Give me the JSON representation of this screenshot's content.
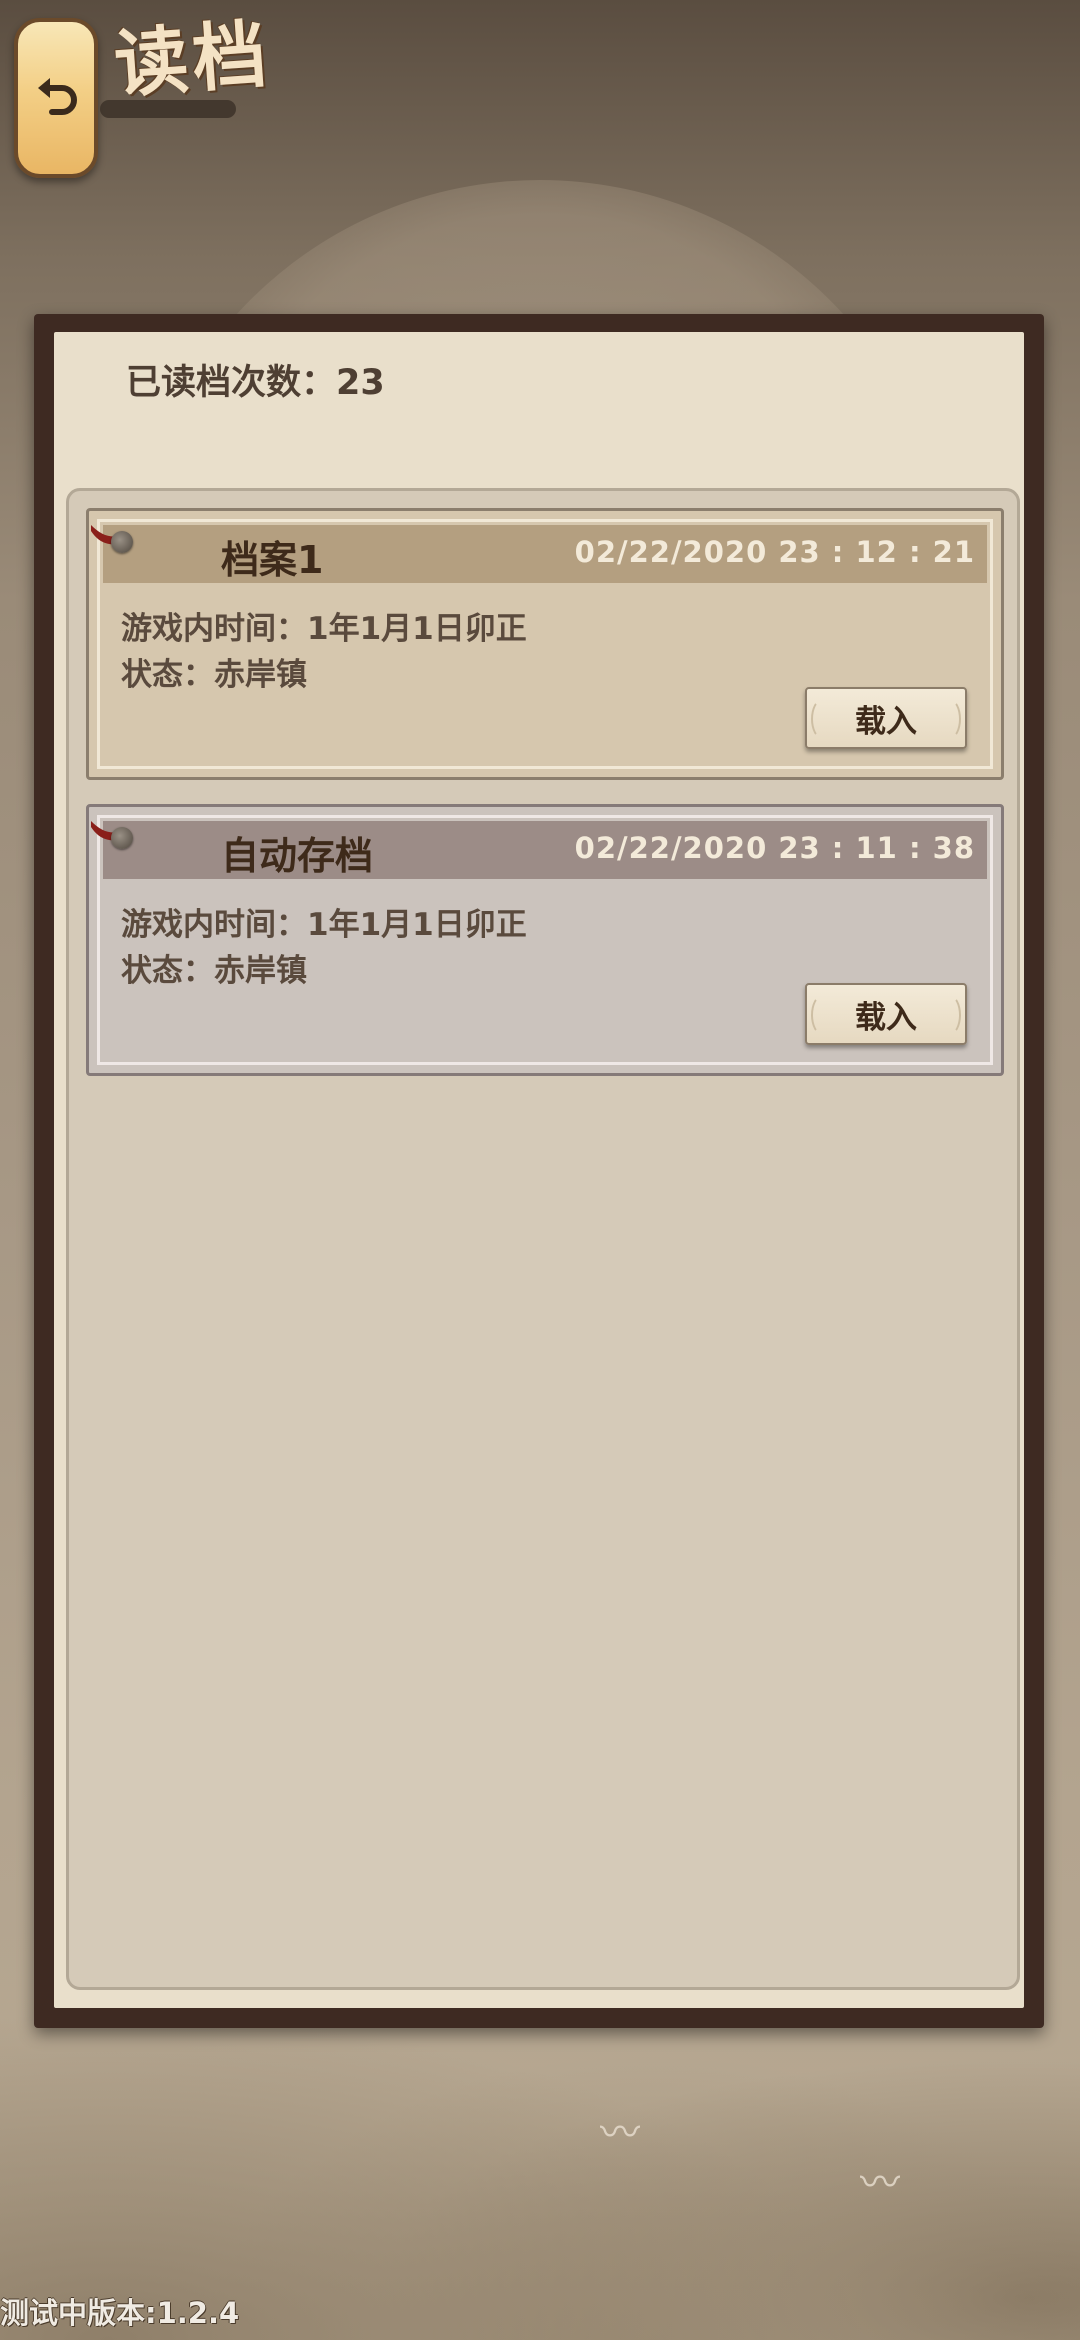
{
  "header": {
    "title": "读档",
    "back_icon": "back-arrow-icon"
  },
  "read_count_label": "已读档次数：23",
  "saves": [
    {
      "name": "档案1",
      "timestamp": "02/22/2020  23 : 12 : 21",
      "game_time": "游戏内时间：1年1月1日卯正",
      "status": "状态：赤岸镇",
      "load_label": "载入"
    },
    {
      "name": "自动存档",
      "timestamp": "02/22/2020  23 : 11 : 38",
      "game_time": "游戏内时间：1年1月1日卯正",
      "status": "状态：赤岸镇",
      "load_label": "载入"
    }
  ],
  "version_label": "测试中版本:1.2.4",
  "colors": {
    "frame": "#3e2a22",
    "paper": "#e9dfcb",
    "save_header_1": "#b49f80",
    "save_header_2": "#9c8c87",
    "accent_text": "#3e2a1a"
  }
}
